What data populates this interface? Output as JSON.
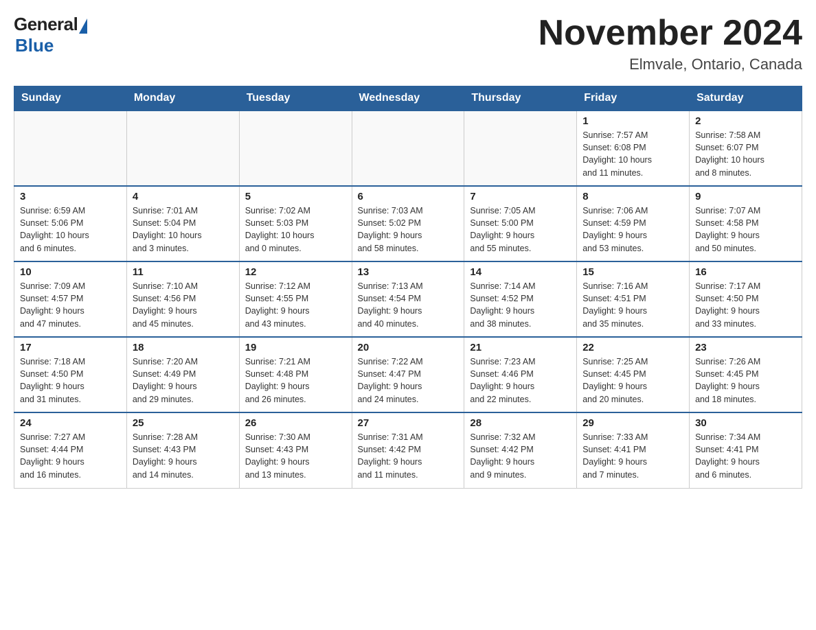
{
  "header": {
    "logo_general": "General",
    "logo_blue": "Blue",
    "month_title": "November 2024",
    "location": "Elmvale, Ontario, Canada"
  },
  "days_of_week": [
    "Sunday",
    "Monday",
    "Tuesday",
    "Wednesday",
    "Thursday",
    "Friday",
    "Saturday"
  ],
  "weeks": [
    {
      "days": [
        {
          "num": "",
          "info": ""
        },
        {
          "num": "",
          "info": ""
        },
        {
          "num": "",
          "info": ""
        },
        {
          "num": "",
          "info": ""
        },
        {
          "num": "",
          "info": ""
        },
        {
          "num": "1",
          "info": "Sunrise: 7:57 AM\nSunset: 6:08 PM\nDaylight: 10 hours\nand 11 minutes."
        },
        {
          "num": "2",
          "info": "Sunrise: 7:58 AM\nSunset: 6:07 PM\nDaylight: 10 hours\nand 8 minutes."
        }
      ]
    },
    {
      "days": [
        {
          "num": "3",
          "info": "Sunrise: 6:59 AM\nSunset: 5:06 PM\nDaylight: 10 hours\nand 6 minutes."
        },
        {
          "num": "4",
          "info": "Sunrise: 7:01 AM\nSunset: 5:04 PM\nDaylight: 10 hours\nand 3 minutes."
        },
        {
          "num": "5",
          "info": "Sunrise: 7:02 AM\nSunset: 5:03 PM\nDaylight: 10 hours\nand 0 minutes."
        },
        {
          "num": "6",
          "info": "Sunrise: 7:03 AM\nSunset: 5:02 PM\nDaylight: 9 hours\nand 58 minutes."
        },
        {
          "num": "7",
          "info": "Sunrise: 7:05 AM\nSunset: 5:00 PM\nDaylight: 9 hours\nand 55 minutes."
        },
        {
          "num": "8",
          "info": "Sunrise: 7:06 AM\nSunset: 4:59 PM\nDaylight: 9 hours\nand 53 minutes."
        },
        {
          "num": "9",
          "info": "Sunrise: 7:07 AM\nSunset: 4:58 PM\nDaylight: 9 hours\nand 50 minutes."
        }
      ]
    },
    {
      "days": [
        {
          "num": "10",
          "info": "Sunrise: 7:09 AM\nSunset: 4:57 PM\nDaylight: 9 hours\nand 47 minutes."
        },
        {
          "num": "11",
          "info": "Sunrise: 7:10 AM\nSunset: 4:56 PM\nDaylight: 9 hours\nand 45 minutes."
        },
        {
          "num": "12",
          "info": "Sunrise: 7:12 AM\nSunset: 4:55 PM\nDaylight: 9 hours\nand 43 minutes."
        },
        {
          "num": "13",
          "info": "Sunrise: 7:13 AM\nSunset: 4:54 PM\nDaylight: 9 hours\nand 40 minutes."
        },
        {
          "num": "14",
          "info": "Sunrise: 7:14 AM\nSunset: 4:52 PM\nDaylight: 9 hours\nand 38 minutes."
        },
        {
          "num": "15",
          "info": "Sunrise: 7:16 AM\nSunset: 4:51 PM\nDaylight: 9 hours\nand 35 minutes."
        },
        {
          "num": "16",
          "info": "Sunrise: 7:17 AM\nSunset: 4:50 PM\nDaylight: 9 hours\nand 33 minutes."
        }
      ]
    },
    {
      "days": [
        {
          "num": "17",
          "info": "Sunrise: 7:18 AM\nSunset: 4:50 PM\nDaylight: 9 hours\nand 31 minutes."
        },
        {
          "num": "18",
          "info": "Sunrise: 7:20 AM\nSunset: 4:49 PM\nDaylight: 9 hours\nand 29 minutes."
        },
        {
          "num": "19",
          "info": "Sunrise: 7:21 AM\nSunset: 4:48 PM\nDaylight: 9 hours\nand 26 minutes."
        },
        {
          "num": "20",
          "info": "Sunrise: 7:22 AM\nSunset: 4:47 PM\nDaylight: 9 hours\nand 24 minutes."
        },
        {
          "num": "21",
          "info": "Sunrise: 7:23 AM\nSunset: 4:46 PM\nDaylight: 9 hours\nand 22 minutes."
        },
        {
          "num": "22",
          "info": "Sunrise: 7:25 AM\nSunset: 4:45 PM\nDaylight: 9 hours\nand 20 minutes."
        },
        {
          "num": "23",
          "info": "Sunrise: 7:26 AM\nSunset: 4:45 PM\nDaylight: 9 hours\nand 18 minutes."
        }
      ]
    },
    {
      "days": [
        {
          "num": "24",
          "info": "Sunrise: 7:27 AM\nSunset: 4:44 PM\nDaylight: 9 hours\nand 16 minutes."
        },
        {
          "num": "25",
          "info": "Sunrise: 7:28 AM\nSunset: 4:43 PM\nDaylight: 9 hours\nand 14 minutes."
        },
        {
          "num": "26",
          "info": "Sunrise: 7:30 AM\nSunset: 4:43 PM\nDaylight: 9 hours\nand 13 minutes."
        },
        {
          "num": "27",
          "info": "Sunrise: 7:31 AM\nSunset: 4:42 PM\nDaylight: 9 hours\nand 11 minutes."
        },
        {
          "num": "28",
          "info": "Sunrise: 7:32 AM\nSunset: 4:42 PM\nDaylight: 9 hours\nand 9 minutes."
        },
        {
          "num": "29",
          "info": "Sunrise: 7:33 AM\nSunset: 4:41 PM\nDaylight: 9 hours\nand 7 minutes."
        },
        {
          "num": "30",
          "info": "Sunrise: 7:34 AM\nSunset: 4:41 PM\nDaylight: 9 hours\nand 6 minutes."
        }
      ]
    }
  ]
}
